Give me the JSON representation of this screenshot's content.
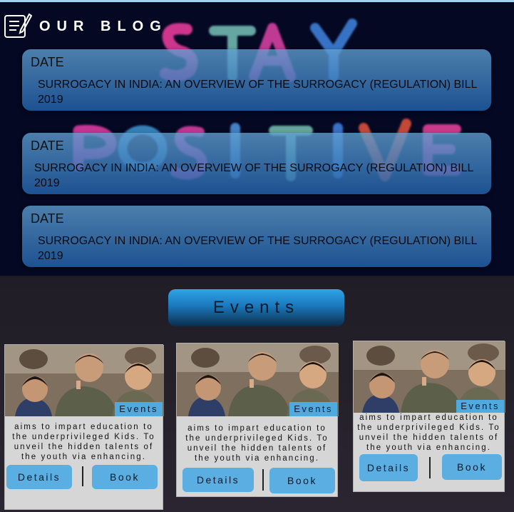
{
  "blog": {
    "title": "OUR BLOG",
    "icon": "notepad-pen-icon",
    "background_words": [
      "STAY",
      "POSITIVE"
    ],
    "posts": [
      {
        "date": "DATE",
        "title": "SURROGACY IN INDIA: AN OVERVIEW OF THE SURROGACY (REGULATION) BILL 2019"
      },
      {
        "date": "DATE",
        "title": "SURROGACY IN INDIA: AN OVERVIEW OF THE SURROGACY (REGULATION) BILL 2019"
      },
      {
        "date": "DATE",
        "title": "SURROGACY IN INDIA: AN OVERVIEW OF THE SURROGACY (REGULATION) BILL 2019"
      }
    ]
  },
  "events": {
    "heading": "Events",
    "cards": [
      {
        "badge": "Events",
        "description": "aims to impart education to the underprivileged Kids. To unveil the hidden talents of the youth via enhancing.",
        "details_label": "Details",
        "book_label": "Book"
      },
      {
        "badge": "Events",
        "description": "aims to impart education to the underprivileged Kids. To unveil the hidden talents of the youth via enhancing.",
        "details_label": "Details",
        "book_label": "Book"
      },
      {
        "badge": "Events",
        "description": "aims to impart education to the underprivileged Kids. To unveil the hidden talents of the youth via enhancing.",
        "details_label": "Details",
        "book_label": "Book"
      }
    ]
  },
  "colors": {
    "blog_bg": "#050823",
    "card_blue": "#2f7fc4",
    "button_blue": "#5aaee2",
    "events_bg": "#201d26"
  }
}
